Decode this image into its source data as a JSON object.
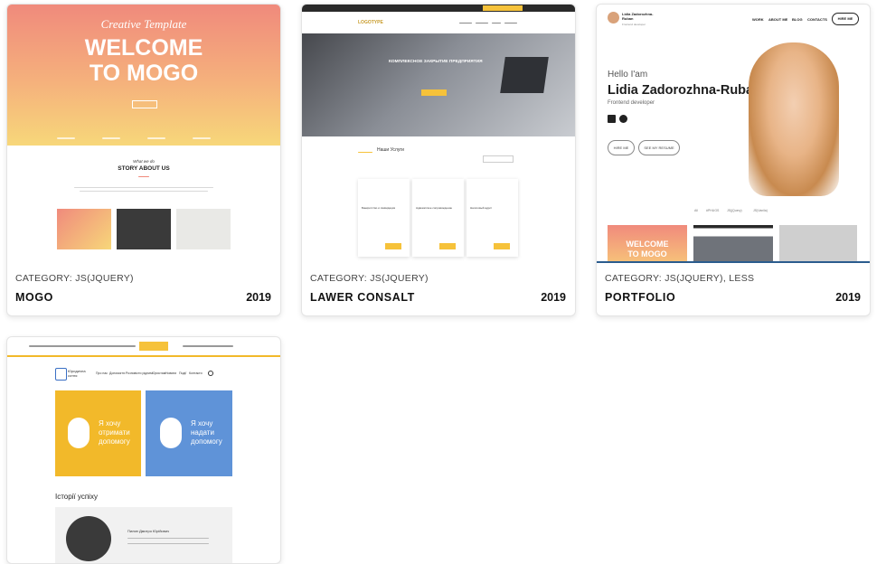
{
  "projects": [
    {
      "category": "CATEGORY: JS(JQUERY)",
      "title": "MOGO",
      "year": "2019",
      "preview": {
        "script_title": "Creative Template",
        "headline_1": "WELCOME",
        "headline_2": "TO MOGO",
        "section_kicker": "What we do",
        "section_title": "STORY ABOUT US",
        "hero_colors": [
          "#f08a7c",
          "#f7d77a"
        ]
      }
    },
    {
      "category": "CATEGORY: JS(JQUERY)",
      "title": "LAWER CONSALT",
      "year": "2019",
      "preview": {
        "logo": "LOGOTYPE",
        "hero_heading": "КОМПЛЕКСНОЕ ЗАКРЫТИЕ ПРЕДПРИЯТИЯ",
        "section_title": "Наши Услуги",
        "cards": [
          "Банкротство и ликвидация",
          "Адвокатское сопровождение",
          "Налоговый аудит"
        ],
        "accent": "#f6c23a"
      }
    },
    {
      "category": "CATEGORY: JS(JQUERY), LESS",
      "title": "PORTFOLIO",
      "year": "2019",
      "preview": {
        "brand_name": "Lidia Zadorozhna-Ruban",
        "brand_role": "Frontend developer",
        "nav": [
          "WORK",
          "ABOUT ME",
          "BLOG",
          "CONTACTS"
        ],
        "hire_btn": "HIRE ME",
        "greeting": "Hello I'am",
        "name": "Lidia Zadorozhna-Ruban",
        "role": "Frontend developer",
        "btn_hire": "HIRE ME",
        "btn_resume": "SEE MY RESUME",
        "filters": [
          "All",
          "#PHUGS",
          "JS(jQuery)",
          "JS(Vanila)"
        ],
        "mini_welcome_1": "WELCOME",
        "mini_welcome_2": "TO MOGO"
      }
    },
    {
      "category": "",
      "title": "",
      "year": "",
      "preview": {
        "logo_text": "Юридична сотня",
        "nav": [
          "Про нас",
          "Допомогти",
          "Розповісти рідним",
          "Юристам",
          "Новини",
          "Події",
          "Контакти"
        ],
        "tile_1": "Я хочу отримати допомогу",
        "tile_2": "Я хочу надати допомогу",
        "section_title": "Історії успіху",
        "person": "Пилип Дмитро Юрійович",
        "tile_colors": [
          "#f2b92a",
          "#5f93d8"
        ]
      }
    }
  ]
}
